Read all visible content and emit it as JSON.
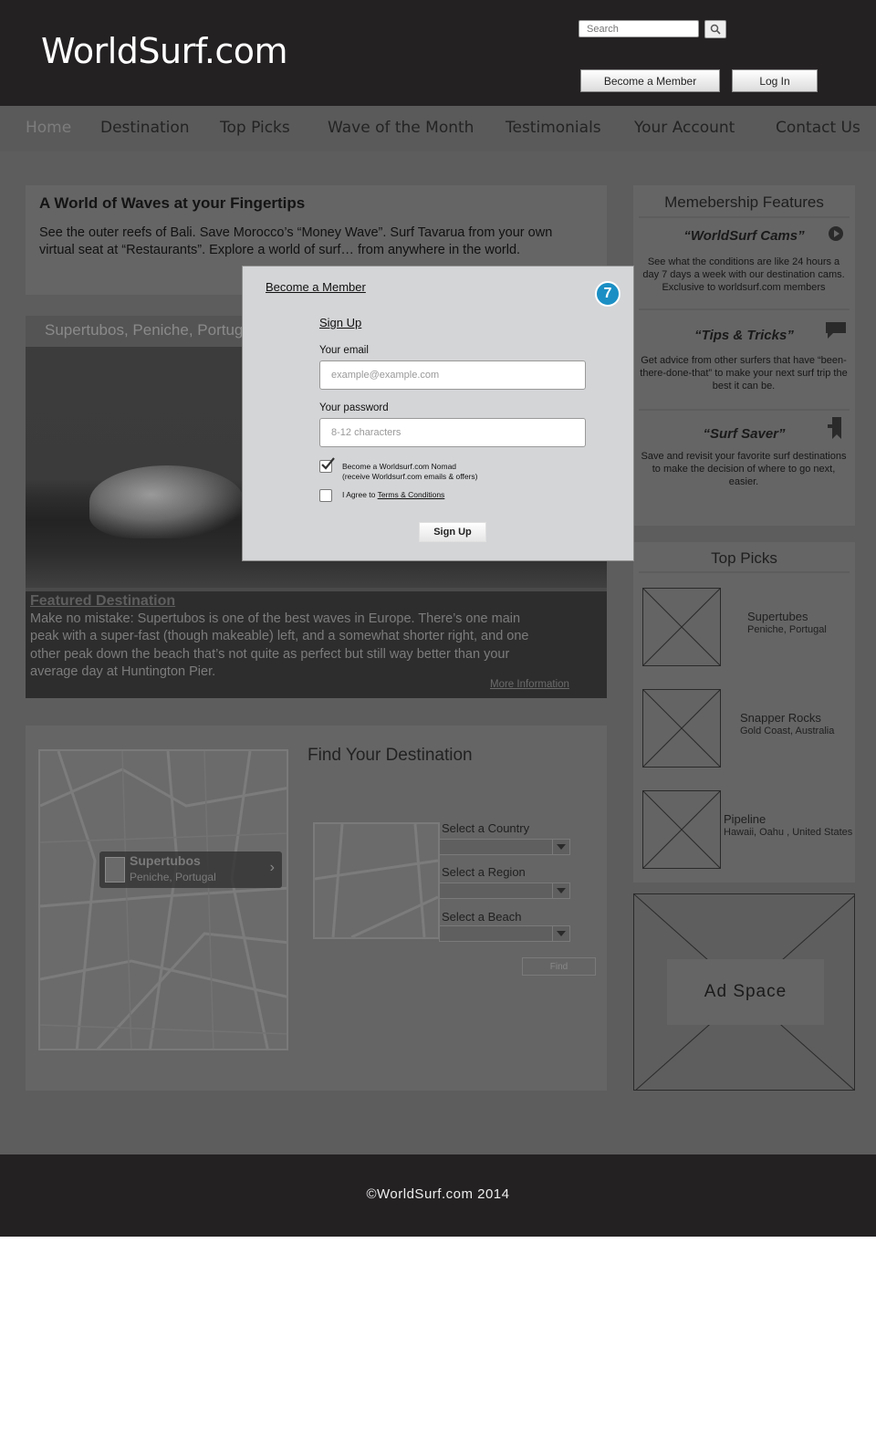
{
  "header": {
    "logo": "WorldSurf.com",
    "search_placeholder": "Search",
    "become_member": "Become a Member",
    "log_in": "Log In"
  },
  "nav": {
    "items": [
      "Home",
      "Destination",
      "Top Picks",
      "Wave of the Month",
      "Testimonials",
      "Your Account",
      "Contact Us"
    ],
    "active": "Home"
  },
  "intro": {
    "title": "A World of Waves at your Fingertips",
    "text": "See the outer reefs of Bali. Save Morocco’s “Money Wave”. Surf Tavarua from your own virtual seat at “Restaurants”. Explore a world of surf… from anywhere in the world."
  },
  "featured": {
    "location": "Supertubos, Peniche, Portugal",
    "caption_title": "Featured Destination",
    "caption_text": "Make no mistake: Supertubos is one of the best waves in Europe. There’s one main peak with a super-fast (though makeable) left, and a somewhat shorter right, and one other peak down the beach that’s not quite as perfect but still way better than your average day at Huntington Pier.",
    "more_info": "More Information"
  },
  "find": {
    "title": "Find Your Destination",
    "map_pin_title": "Supertubos",
    "map_pin_sub": "Peniche, Portugal",
    "country_label": "Select a Country",
    "region_label": "Select a Region",
    "beach_label": "Select a Beach",
    "find_button": "Find"
  },
  "membership": {
    "title": "Memebership Features",
    "features": [
      {
        "name": "“WorldSurf Cams”",
        "desc": "See what the conditions are like 24 hours a day 7 days a week with our destination cams. Exclusive to worldsurf.com members",
        "icon": "play-icon"
      },
      {
        "name": "“Tips & Tricks”",
        "desc": "Get advice from other surfers that have “been-there-done-that” to make your next surf trip the best it can be.",
        "icon": "speech-bubble-icon"
      },
      {
        "name": "“Surf Saver”",
        "desc": "Save and revisit your favorite surf destinations to make the decision of where to go next, easier.",
        "icon": "bookmark-icon"
      }
    ]
  },
  "top_picks": {
    "title": "Top Picks",
    "items": [
      {
        "name": "Supertubes",
        "location": "Peniche, Portugal"
      },
      {
        "name": "Snapper Rocks",
        "location": "Gold Coast, Australia"
      },
      {
        "name": "Pipeline",
        "location": "Hawaii, Oahu , United States"
      }
    ]
  },
  "ad": {
    "label": "Ad Space"
  },
  "footer": {
    "text": "©WorldSurf.com 2014"
  },
  "modal": {
    "heading": "Become a Member",
    "badge": "7",
    "subheading": "Sign Up",
    "email_label": "Your email",
    "email_placeholder": "example@example.com",
    "password_label": "Your password",
    "password_placeholder": "8-12 characters",
    "nomad_line1": "Become a Worldsurf.com Nomad",
    "nomad_line2": "(receive Worldsurf.com emails & offers)",
    "nomad_checked": true,
    "agree_prefix": "I Agree to ",
    "agree_link": "Terms & Conditions",
    "agree_checked": false,
    "submit": "Sign Up"
  },
  "colors": {
    "header_bg": "#242123",
    "overlay_bg": "#5d5d5d",
    "modal_bg": "#d4d5d7",
    "badge_blue": "#1b8fc4"
  }
}
